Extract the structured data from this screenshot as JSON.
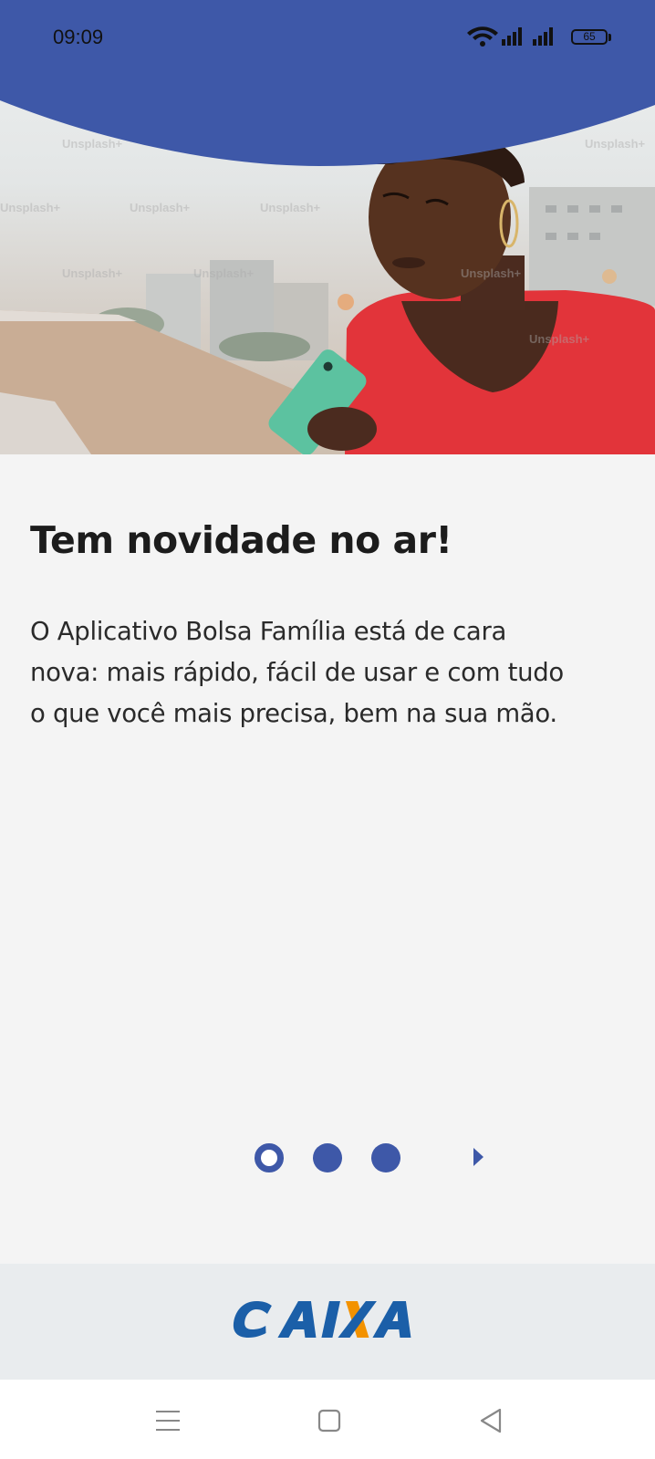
{
  "status_bar": {
    "time": "09:09",
    "battery": "65",
    "icons": [
      "wifi-icon",
      "signal-icon",
      "signal-icon",
      "battery-icon"
    ]
  },
  "hero": {
    "watermark": "Unsplash+",
    "accent_color": "#3e58a8"
  },
  "onboarding": {
    "title": "Tem novidade no ar!",
    "lines": [
      "O Aplicativo Bolsa Família está de cara",
      "nova: mais rápido, fácil de usar e com tudo",
      "o que você mais precisa, bem na sua mão."
    ]
  },
  "pager": {
    "pages": 3,
    "current": 1,
    "next_icon": "chevron-right-icon"
  },
  "footer": {
    "logo_text": "CAIXA",
    "logo_colors": {
      "blue": "#1b5fa8",
      "orange": "#f39200"
    }
  },
  "navigation_bar": {
    "buttons": [
      "menu-icon",
      "home-icon",
      "back-icon"
    ]
  }
}
